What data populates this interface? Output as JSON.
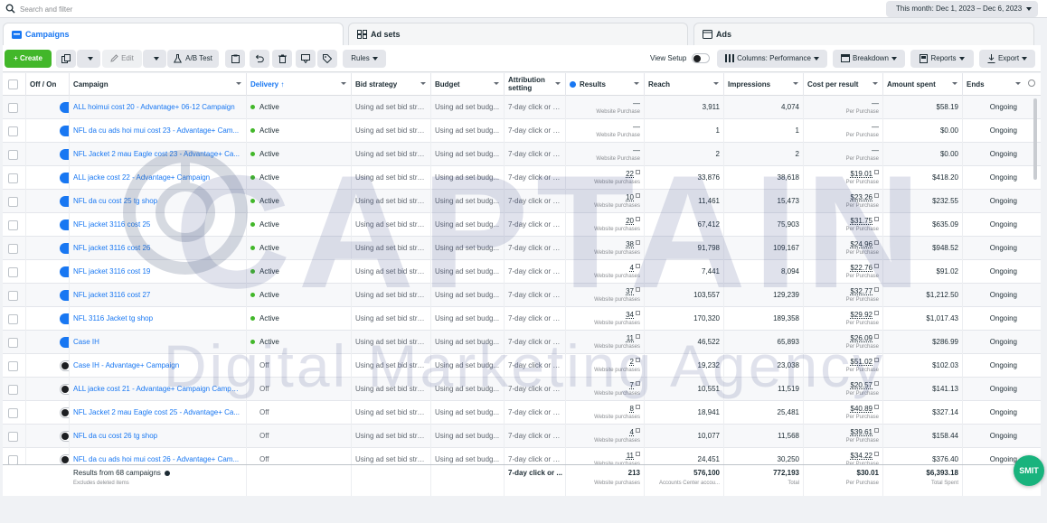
{
  "search": {
    "placeholder": "Search and filter"
  },
  "date_range": "This month: Dec 1, 2023 – Dec 6, 2023",
  "tabs": [
    {
      "label": "Campaigns",
      "icon": "folder-icon",
      "active": true
    },
    {
      "label": "Ad sets",
      "icon": "grid-icon",
      "active": false
    },
    {
      "label": "Ads",
      "icon": "ad-page-icon",
      "active": false
    }
  ],
  "toolbar": {
    "create": "+ Create",
    "edit": "Edit",
    "ab_test": "A/B Test",
    "rules": "Rules",
    "view_setup": "View Setup",
    "columns": "Columns: Performance",
    "breakdown": "Breakdown",
    "reports": "Reports",
    "export": "Export"
  },
  "columns": {
    "off_on": "Off / On",
    "campaign": "Campaign",
    "delivery": "Delivery ↑",
    "bid_strategy": "Bid strategy",
    "budget": "Budget",
    "attribution": "Attribution setting",
    "results": "Results",
    "reach": "Reach",
    "impressions": "Impressions",
    "cost_per_result": "Cost per result",
    "amount_spent": "Amount spent",
    "ends": "Ends"
  },
  "rows": [
    {
      "on": true,
      "name": "ALL hoimui cost 20 - Advantage+ 06-12 Campaign",
      "delivery": "Active",
      "bid": "Using ad set bid stra...",
      "budget": "Using ad set budg...",
      "attr": "7-day click or 1...",
      "results": "—",
      "results_sub": "Website Purchase",
      "reach": "3,911",
      "impressions": "4,074",
      "cpr": "—",
      "cpr_sub": "Per Purchase",
      "spent": "$58.19",
      "ends": "Ongoing"
    },
    {
      "on": true,
      "name": "NFL da cu ads hoi mui cost 23 - Advantage+ Cam...",
      "delivery": "Active",
      "bid": "Using ad set bid stra...",
      "budget": "Using ad set budg...",
      "attr": "7-day click or 1...",
      "results": "—",
      "results_sub": "Website Purchase",
      "reach": "1",
      "impressions": "1",
      "cpr": "—",
      "cpr_sub": "Per Purchase",
      "spent": "$0.00",
      "ends": "Ongoing"
    },
    {
      "on": true,
      "name": "NFL Jacket 2 mau Eagle cost 23 - Advantage+ Ca...",
      "delivery": "Active",
      "bid": "Using ad set bid stra...",
      "budget": "Using ad set budg...",
      "attr": "7-day click or 1...",
      "results": "—",
      "results_sub": "Website Purchase",
      "reach": "2",
      "impressions": "2",
      "cpr": "—",
      "cpr_sub": "Per Purchase",
      "spent": "$0.00",
      "ends": "Ongoing"
    },
    {
      "on": true,
      "name": "ALL jacke cost 22 - Advantage+ Campaign",
      "delivery": "Active",
      "bid": "Using ad set bid stra...",
      "budget": "Using ad set budg...",
      "attr": "7-day click or 1...",
      "results": "22",
      "results_sub": "Website purchases",
      "reach": "33,876",
      "impressions": "38,618",
      "cpr": "$19.01",
      "cpr_sub": "Per Purchase",
      "spent": "$418.20",
      "ends": "Ongoing"
    },
    {
      "on": true,
      "name": "NFL da cu cost 25 tg shop",
      "delivery": "Active",
      "bid": "Using ad set bid stra...",
      "budget": "Using ad set budg...",
      "attr": "7-day click or 1...",
      "results": "10",
      "results_sub": "Website purchases",
      "reach": "11,461",
      "impressions": "15,473",
      "cpr": "$23.26",
      "cpr_sub": "Per Purchase",
      "spent": "$232.55",
      "ends": "Ongoing"
    },
    {
      "on": true,
      "name": "NFL jacket 3116 cost 25",
      "delivery": "Active",
      "bid": "Using ad set bid stra...",
      "budget": "Using ad set budg...",
      "attr": "7-day click or 1...",
      "results": "20",
      "results_sub": "Website purchases",
      "reach": "67,412",
      "impressions": "75,903",
      "cpr": "$31.75",
      "cpr_sub": "Per Purchase",
      "spent": "$635.09",
      "ends": "Ongoing"
    },
    {
      "on": true,
      "name": "NFL jacket 3116 cost 26",
      "delivery": "Active",
      "bid": "Using ad set bid stra...",
      "budget": "Using ad set budg...",
      "attr": "7-day click or 1...",
      "results": "38",
      "results_sub": "Website purchases",
      "reach": "91,798",
      "impressions": "109,167",
      "cpr": "$24.96",
      "cpr_sub": "Per Purchase",
      "spent": "$948.52",
      "ends": "Ongoing"
    },
    {
      "on": true,
      "name": "NFL jacket 3116 cost 19",
      "delivery": "Active",
      "bid": "Using ad set bid stra...",
      "budget": "Using ad set budg...",
      "attr": "7-day click or 1...",
      "results": "4",
      "results_sub": "Website purchases",
      "reach": "7,441",
      "impressions": "8,094",
      "cpr": "$22.76",
      "cpr_sub": "Per Purchase",
      "spent": "$91.02",
      "ends": "Ongoing"
    },
    {
      "on": true,
      "name": "NFL jacket 3116 cost 27",
      "delivery": "Active",
      "bid": "Using ad set bid stra...",
      "budget": "Using ad set budg...",
      "attr": "7-day click or 1...",
      "results": "37",
      "results_sub": "Website purchases",
      "reach": "103,557",
      "impressions": "129,239",
      "cpr": "$32.77",
      "cpr_sub": "Per Purchase",
      "spent": "$1,212.50",
      "ends": "Ongoing"
    },
    {
      "on": true,
      "name": "NFL 3116 Jacket tg shop",
      "delivery": "Active",
      "bid": "Using ad set bid stra...",
      "budget": "Using ad set budg...",
      "attr": "7-day click or 1...",
      "results": "34",
      "results_sub": "Website purchases",
      "reach": "170,320",
      "impressions": "189,358",
      "cpr": "$29.92",
      "cpr_sub": "Per Purchase",
      "spent": "$1,017.43",
      "ends": "Ongoing"
    },
    {
      "on": true,
      "name": "Case IH",
      "delivery": "Active",
      "bid": "Using ad set bid stra...",
      "budget": "Using ad set budg...",
      "attr": "7-day click or 1...",
      "results": "11",
      "results_sub": "Website purchases",
      "reach": "46,522",
      "impressions": "65,893",
      "cpr": "$26.09",
      "cpr_sub": "Per Purchase",
      "spent": "$286.99",
      "ends": "Ongoing"
    },
    {
      "on": false,
      "name": "Case IH - Advantage+ Campaign",
      "delivery": "Off",
      "bid": "Using ad set bid stra...",
      "budget": "Using ad set budg...",
      "attr": "7-day click or 1...",
      "results": "2",
      "results_sub": "Website purchases",
      "reach": "19,232",
      "impressions": "23,038",
      "cpr": "$51.02",
      "cpr_sub": "Per Purchase",
      "spent": "$102.03",
      "ends": "Ongoing"
    },
    {
      "on": false,
      "name": "ALL jacke cost 21 - Advantage+ Campaign Campai...",
      "delivery": "Off",
      "bid": "Using ad set bid stra...",
      "budget": "Using ad set budg...",
      "attr": "7-day click or 1...",
      "results": "7",
      "results_sub": "Website purchases",
      "reach": "10,551",
      "impressions": "11,519",
      "cpr": "$20.57",
      "cpr_sub": "Per Purchase",
      "spent": "$141.13",
      "ends": "Ongoing"
    },
    {
      "on": false,
      "name": "NFL Jacket 2 mau Eagle cost 25 - Advantage+ Ca...",
      "delivery": "Off",
      "bid": "Using ad set bid stra...",
      "budget": "Using ad set budg...",
      "attr": "7-day click or 1...",
      "results": "8",
      "results_sub": "Website purchases",
      "reach": "18,941",
      "impressions": "25,481",
      "cpr": "$40.89",
      "cpr_sub": "Per Purchase",
      "spent": "$327.14",
      "ends": "Ongoing"
    },
    {
      "on": false,
      "name": "NFL da cu cost 26 tg shop",
      "delivery": "Off",
      "bid": "Using ad set bid stra...",
      "budget": "Using ad set budg...",
      "attr": "7-day click or 1...",
      "results": "4",
      "results_sub": "Website purchases",
      "reach": "10,077",
      "impressions": "11,568",
      "cpr": "$39.61",
      "cpr_sub": "Per Purchase",
      "spent": "$158.44",
      "ends": "Ongoing"
    },
    {
      "on": false,
      "name": "NFL da cu ads hoi mui cost 26 - Advantage+ Cam...",
      "delivery": "Off",
      "bid": "Using ad set bid stra...",
      "budget": "Using ad set budg...",
      "attr": "7-day click or 1...",
      "results": "11",
      "results_sub": "Website purchases",
      "reach": "24,451",
      "impressions": "30,250",
      "cpr": "$34.22",
      "cpr_sub": "Per Purchase",
      "spent": "$376.40",
      "ends": "Ongoing"
    }
  ],
  "summary": {
    "label": "Results from 68 campaigns",
    "sub": "Excludes deleted items",
    "attr": "7-day click or ...",
    "results": "213",
    "results_sub": "Website purchases",
    "reach": "576,100",
    "reach_sub": "Accounts Center accou...",
    "impressions": "772,193",
    "impressions_sub": "Total",
    "cpr": "$30.01",
    "cpr_sub": "Per Purchase",
    "spent": "$6,393.18",
    "spent_sub": "Total Spent"
  },
  "watermark": {
    "title": "CAPTAIN",
    "subtitle": "Digital Marketing Agency"
  },
  "badge": "SMIT",
  "colors": {
    "accent": "#1877f2",
    "create": "#42b72a",
    "active_dot": "#42b72a",
    "badge": "#19b37d"
  }
}
